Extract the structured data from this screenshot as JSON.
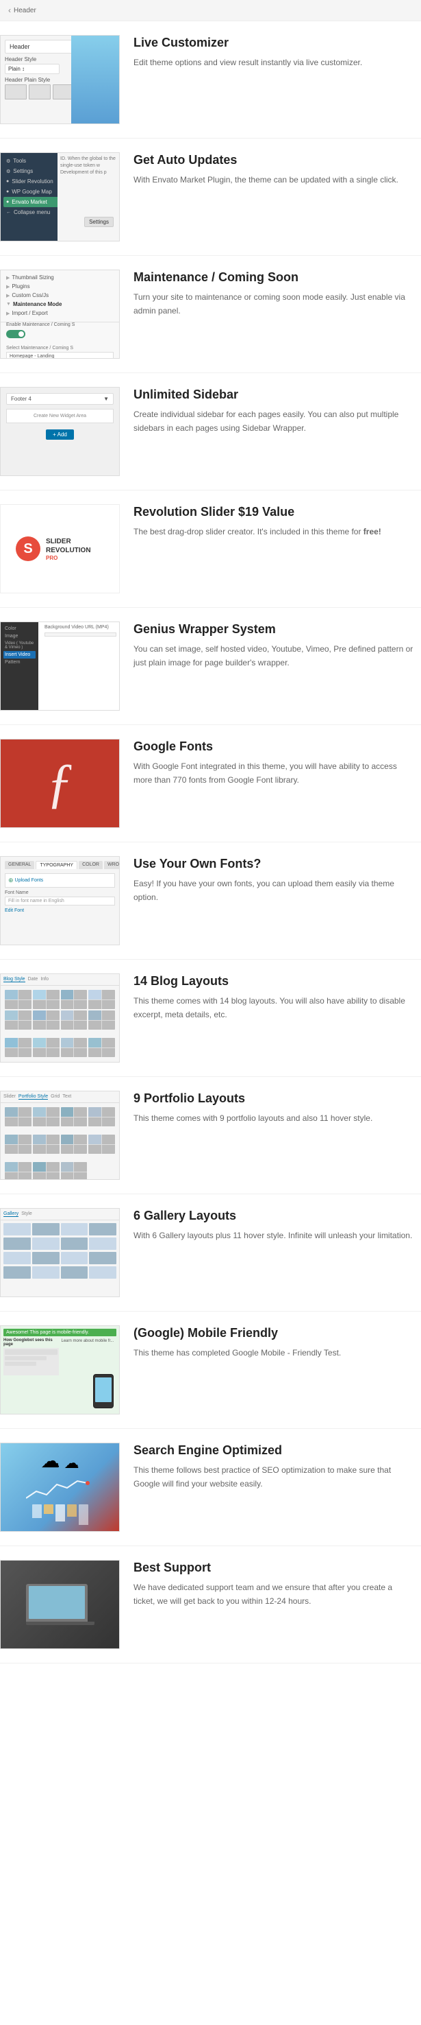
{
  "header": {
    "back_label": "‹",
    "title": "Header"
  },
  "features": [
    {
      "id": "live-customizer",
      "title": "Live Customizer",
      "description": "Edit theme options and view result instantly via live customizer.",
      "image_type": "customizer",
      "header_style_label": "Header Style",
      "plain_label": "Plain",
      "header_plain_style_label": "Header Plain Style"
    },
    {
      "id": "auto-updates",
      "title": "Get Auto Updates",
      "description": "With Envato Market Plugin, the theme can be updated with a single click.",
      "image_type": "updates",
      "menu_items": [
        "Tools",
        "Settings",
        "Slider Revolution",
        "WP Google Map",
        "Envato Market",
        "Collapse menu"
      ],
      "settings_label": "Settings",
      "id_text": "ID. When the global to the single-use token w Development of this p"
    },
    {
      "id": "maintenance",
      "title": "Maintenance / Coming Soon",
      "description": "Turn your site to maintenance or coming soon mode easily. Just enable via admin panel.",
      "image_type": "maintenance",
      "items": [
        "Thumbnail Sizing",
        "Plugins",
        "Custom Css/Js",
        "Maintenance Mode",
        "Import / Export"
      ],
      "enable_label": "Enable Maintenance / Coming S",
      "toggle_on": true,
      "select_label": "Select Maintenance / Coming S",
      "homepage_option": "Homepage - Landing"
    },
    {
      "id": "unlimited-sidebar",
      "title": "Unlimited Sidebar",
      "description": "Create individual sidebar for each pages easily. You can also put multiple sidebars in each pages using Sidebar Wrapper.",
      "image_type": "sidebar",
      "footer_label": "Footer 4",
      "create_widget_label": "Create New Widget Area",
      "add_label": "+ Add"
    },
    {
      "id": "revolution-slider",
      "title": "Revolution Slider $19 Value",
      "description": "The best drag-drop slider creator. It's included in this theme for free!",
      "image_type": "slider",
      "slider_brand": "SLIDER REVOLUTION",
      "slider_pro": "PRO"
    },
    {
      "id": "genius-wrapper",
      "title": "Genius Wrapper System",
      "description": "You can set image, self hosted video, Youtube, Vimeo, Pre defined pattern or just plain image for page builder's wrapper.",
      "image_type": "wrapper",
      "menu_items": [
        "Color",
        "Image",
        "Video ( Youtube & Vimeo )",
        "Insert Video",
        "Pattern"
      ],
      "bg_video_label": "Background Video URL (MP4)"
    },
    {
      "id": "google-fonts",
      "title": "Google Fonts",
      "description": "With Google Font integrated in this theme, you will have ability to access more than 770 fonts from Google Font library.",
      "image_type": "fonts",
      "letter": "ƒ"
    },
    {
      "id": "own-fonts",
      "title": "Use Your Own Fonts?",
      "description": "Easy! If you have your own fonts, you can upload them easily via theme option.",
      "image_type": "own-fonts",
      "tabs": [
        "GENERAL",
        "TYPOGRAPHY",
        "COLOR",
        "WROO"
      ],
      "upload_label": "Upload Fonts",
      "font_name_label": "Font Name",
      "font_name_placeholder": "Fill in font name in English",
      "edit_font_label": "Edit Font"
    },
    {
      "id": "blog-layouts",
      "title": "14 Blog Layouts",
      "description": "This theme comes with 14 blog layouts. You will also have ability to disable excerpt, meta details, etc.",
      "image_type": "blog",
      "tabs": [
        "Blog Style",
        "Date",
        "Info"
      ]
    },
    {
      "id": "portfolio-layouts",
      "title": "9 Portfolio Layouts",
      "description": "This theme comes with 9 portfolio layouts and also 11 hover style.",
      "image_type": "portfolio",
      "tabs": [
        "Slider",
        "Portfolio Style",
        "Grid",
        "Text"
      ]
    },
    {
      "id": "gallery-layouts",
      "title": "6 Gallery Layouts",
      "description": "With 6 Gallery layouts plus 11 hover style. Infinite will unleash your limitation.",
      "image_type": "gallery",
      "tabs": [
        "Gallery",
        "Style"
      ]
    },
    {
      "id": "mobile-friendly",
      "title": "(Google) Mobile Friendly",
      "description": "This theme has completed Google Mobile - Friendly Test.",
      "image_type": "mobile",
      "banner_text": "Awesome! This page is mobile-friendly.",
      "how_label": "How Googlebot sees this page",
      "learn_label": "Learn more about mobile fr..."
    },
    {
      "id": "seo",
      "title": "Search Engine Optimized",
      "description": "This theme follows best practice of SEO optimization to make sure that Google will find your website easily.",
      "image_type": "seo"
    },
    {
      "id": "support",
      "title": "Best Support",
      "description": "We have dedicated support team and we ensure that after you create a ticket, we will get back to you within 12-24 hours.",
      "image_type": "support"
    }
  ]
}
